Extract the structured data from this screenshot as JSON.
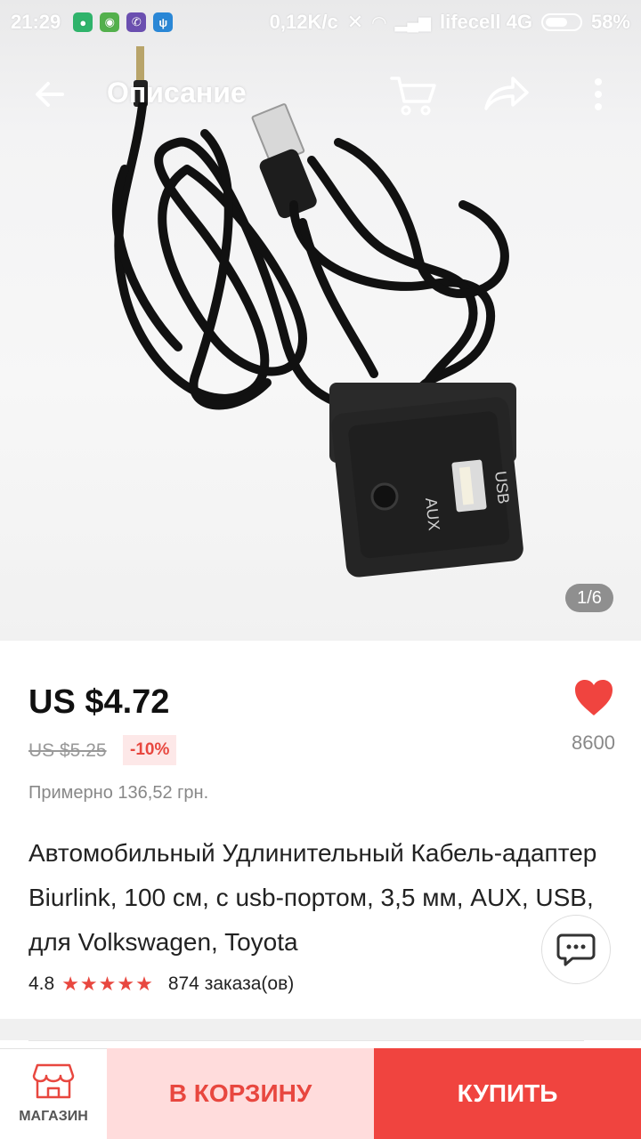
{
  "status_bar": {
    "time": "21:29",
    "network_speed": "0,12K/c",
    "carrier": "lifecell 4G",
    "battery": "58%"
  },
  "header": {
    "title": "Описание",
    "back_icon": "arrow-left-icon",
    "cart_icon": "cart-icon",
    "share_icon": "share-icon",
    "more_icon": "more-vertical-icon"
  },
  "gallery": {
    "counter": "1/6",
    "image_description_labels": [
      "USB",
      "AUX"
    ]
  },
  "product": {
    "price": "US $4.72",
    "old_price": "US $5.25",
    "discount": "-10%",
    "approx_price": "Примерно 136,52 грн.",
    "wishlist_count": "8600",
    "title": "Автомобильный Удлинительный Кабель-адаптер Biurlink, 100 см, с usb-портом, 3,5 мм, AUX, USB, для Volkswagen, Toyota",
    "rating": "4.8",
    "stars": "★★★★★",
    "orders": "874 заказа(ов)"
  },
  "bottom_bar": {
    "store_label": "МАГАЗИН",
    "add_to_cart_label": "В КОРЗИНУ",
    "buy_label": "КУПИТЬ"
  },
  "colors": {
    "accent": "#f0443f",
    "accent_light": "#ffdcdc",
    "text_muted": "#888888"
  }
}
